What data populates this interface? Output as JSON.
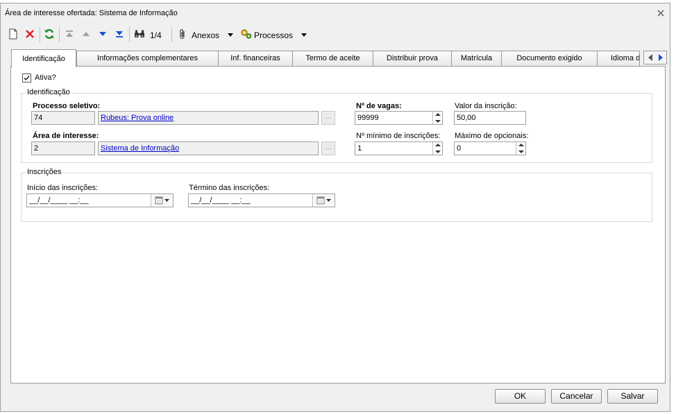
{
  "window": {
    "title": "Área de interesse ofertada: Sistema de Informação"
  },
  "toolbar": {
    "record_position": "1/4",
    "attachments_label": "Anexos",
    "processes_label": "Processos"
  },
  "tabs": [
    {
      "label": "Identificação",
      "active": true
    },
    {
      "label": "Informações complementares"
    },
    {
      "label": "Inf. financeiras"
    },
    {
      "label": "Termo de aceite"
    },
    {
      "label": "Distribuir prova"
    },
    {
      "label": "Matrícula"
    },
    {
      "label": "Documento exigido"
    },
    {
      "label": "Idioma d"
    }
  ],
  "form": {
    "active_label": "Ativa?",
    "active_checked": true,
    "identification": {
      "legend": "Identificação",
      "process_label": "Processo seletivo:",
      "process_code": "74",
      "process_name": "Rubeus: Prova online",
      "area_label": "Área de interesse:",
      "area_code": "2",
      "area_name": "Sistema de Informação",
      "vacancies_label": "Nº de vagas:",
      "vacancies_value": "99999",
      "fee_label": "Valor da inscrição:",
      "fee_value": "50,00",
      "min_enrollments_label": "Nº mínimo de inscrições:",
      "min_enrollments_value": "1",
      "max_optionals_label": "Máximo de opcionais:",
      "max_optionals_value": "0",
      "ellipsis": "..."
    },
    "registrations": {
      "legend": "Inscrições",
      "start_label": "Início das inscrições:",
      "start_value": "__/__/____ __:__",
      "end_label": "Término das inscrições:",
      "end_value": "__/__/____ __:__"
    }
  },
  "buttons": {
    "ok": "OK",
    "cancel": "Cancelar",
    "save": "Salvar"
  },
  "colors": {
    "accent_blue": "#1a4fd0",
    "delete_red": "#e02020",
    "refresh_green": "#2a8a2a",
    "link": "#0000cc"
  }
}
